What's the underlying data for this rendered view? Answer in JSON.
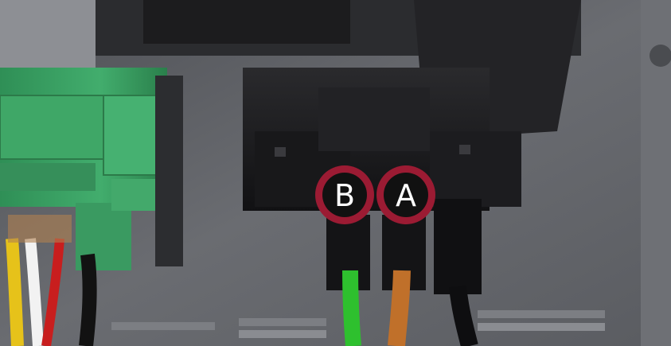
{
  "markers": [
    {
      "id": "marker-b",
      "label": "B",
      "wire_color_name": "green"
    },
    {
      "id": "marker-a",
      "label": "A",
      "wire_color_name": "orange"
    }
  ],
  "colors": {
    "marker_ring": "#9b1b33",
    "marker_fill": "#111111",
    "marker_text": "#ffffff",
    "terminal_block": "#3aa063",
    "connector_body": "#1a1a1c",
    "panel_background": "#5f6166",
    "wire_green": "#2ec02e",
    "wire_orange": "#c0702a",
    "wire_yellow": "#e6c21a",
    "wire_white": "#f2f2f2",
    "wire_red": "#c81e1e"
  }
}
